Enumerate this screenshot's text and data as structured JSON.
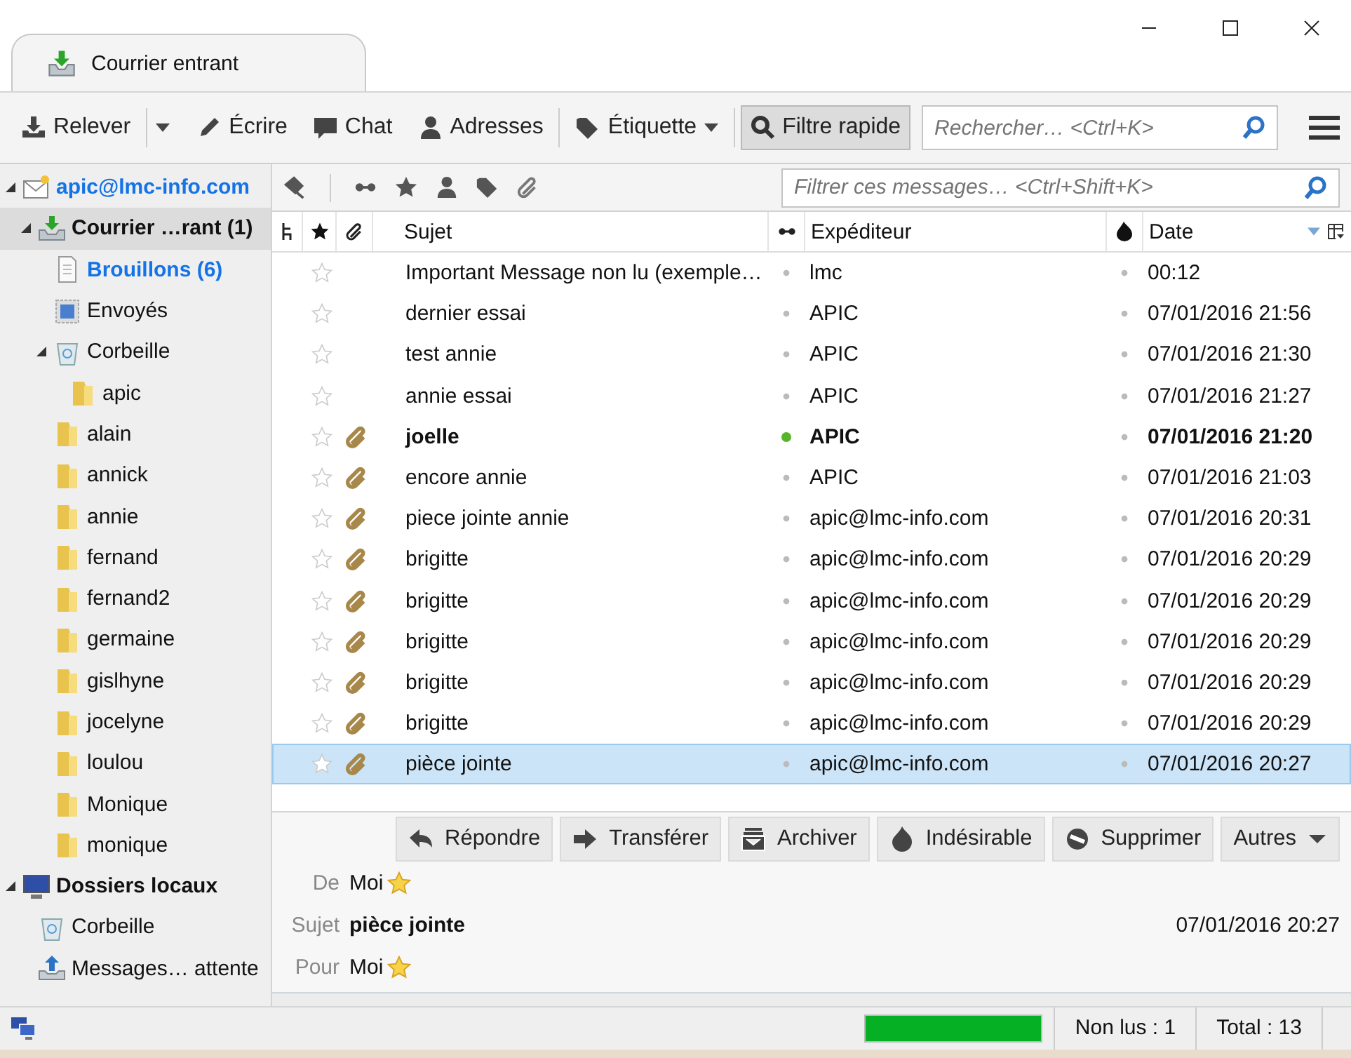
{
  "tab": {
    "title": "Courrier entrant"
  },
  "toolbar": {
    "buttons": [
      {
        "label": "Relever",
        "kind": "get",
        "split": true
      },
      {
        "label": "Écrire",
        "kind": "write",
        "split": false
      },
      {
        "label": "Chat",
        "kind": "chat",
        "split": false
      },
      {
        "label": "Adresses",
        "kind": "contacts",
        "split": false
      },
      {
        "label": "Étiquette",
        "kind": "tag",
        "split": false
      },
      {
        "label": "Filtre rapide",
        "kind": "filter",
        "split": false,
        "selected": true
      }
    ],
    "search": {
      "placeholder": "Rechercher… <Ctrl+K>"
    }
  },
  "sidebar": {
    "items": [
      {
        "label": "apic@lmc-info.com",
        "kind": "account",
        "selected": false,
        "expanded": true,
        "children": [
          {
            "label": "Courrier …rant (1)",
            "kind": "inbox",
            "selected": true,
            "expanded": true,
            "unread": true,
            "children": [
              {
                "label": "Brouillons (6)",
                "kind": "drafts",
                "selected": false,
                "unread": true,
                "new": true
              },
              {
                "label": "Envoyés",
                "kind": "sent",
                "selected": false
              },
              {
                "label": "Corbeille",
                "kind": "trash",
                "selected": false,
                "expanded": true,
                "children": [
                  {
                    "label": "apic",
                    "kind": "folder",
                    "selected": false
                  }
                ]
              },
              {
                "label": "alain",
                "kind": "folder",
                "selected": false
              },
              {
                "label": "annick",
                "kind": "folder",
                "selected": false
              },
              {
                "label": "annie",
                "kind": "folder",
                "selected": false
              },
              {
                "label": "fernand",
                "kind": "folder",
                "selected": false
              },
              {
                "label": "fernand2",
                "kind": "folder",
                "selected": false
              },
              {
                "label": "germaine",
                "kind": "folder",
                "selected": false
              },
              {
                "label": "gislhyne",
                "kind": "folder",
                "selected": false
              },
              {
                "label": "jocelyne",
                "kind": "folder",
                "selected": false
              },
              {
                "label": "loulou",
                "kind": "folder",
                "selected": false
              },
              {
                "label": "Monique",
                "kind": "folder",
                "selected": false
              },
              {
                "label": "monique",
                "kind": "folder",
                "selected": false
              }
            ]
          }
        ]
      },
      {
        "label": "Dossiers locaux",
        "kind": "local",
        "selected": false,
        "expanded": true,
        "children": [
          {
            "label": "Corbeille",
            "kind": "trash",
            "selected": false
          },
          {
            "label": "Messages… attente",
            "kind": "outbox",
            "selected": false
          }
        ]
      }
    ]
  },
  "quick_filter": {
    "placeholder": "Filtrer ces messages… <Ctrl+Shift+K>"
  },
  "table": {
    "columns": [
      {
        "label": "Sujet"
      },
      {
        "label": "Expéditeur"
      },
      {
        "label": "Date"
      }
    ],
    "rows": [
      {
        "subject": "Important Message non lu (exemple…",
        "sender": "lmc",
        "date": "00:12",
        "starred": false,
        "attachment": false,
        "unread": false,
        "selected": false
      },
      {
        "subject": "dernier essai",
        "sender": "APIC",
        "date": "07/01/2016 21:56",
        "starred": false,
        "attachment": false,
        "unread": false,
        "selected": false
      },
      {
        "subject": "test annie",
        "sender": "APIC",
        "date": "07/01/2016 21:30",
        "starred": false,
        "attachment": false,
        "unread": false,
        "selected": false
      },
      {
        "subject": "annie essai",
        "sender": "APIC",
        "date": "07/01/2016 21:27",
        "starred": false,
        "attachment": false,
        "unread": false,
        "selected": false
      },
      {
        "subject": "joelle",
        "sender": "APIC",
        "date": "07/01/2016 21:20",
        "starred": false,
        "attachment": true,
        "unread": true,
        "selected": false
      },
      {
        "subject": "encore annie",
        "sender": "APIC",
        "date": "07/01/2016 21:03",
        "starred": false,
        "attachment": true,
        "unread": false,
        "selected": false
      },
      {
        "subject": "piece jointe annie",
        "sender": "apic@lmc-info.com",
        "date": "07/01/2016 20:31",
        "starred": false,
        "attachment": true,
        "unread": false,
        "selected": false
      },
      {
        "subject": "brigitte",
        "sender": "apic@lmc-info.com",
        "date": "07/01/2016 20:29",
        "starred": false,
        "attachment": true,
        "unread": false,
        "selected": false
      },
      {
        "subject": "brigitte",
        "sender": "apic@lmc-info.com",
        "date": "07/01/2016 20:29",
        "starred": false,
        "attachment": true,
        "unread": false,
        "selected": false
      },
      {
        "subject": "brigitte",
        "sender": "apic@lmc-info.com",
        "date": "07/01/2016 20:29",
        "starred": false,
        "attachment": true,
        "unread": false,
        "selected": false
      },
      {
        "subject": "brigitte",
        "sender": "apic@lmc-info.com",
        "date": "07/01/2016 20:29",
        "starred": false,
        "attachment": true,
        "unread": false,
        "selected": false
      },
      {
        "subject": "brigitte",
        "sender": "apic@lmc-info.com",
        "date": "07/01/2016 20:29",
        "starred": false,
        "attachment": true,
        "unread": false,
        "selected": false
      },
      {
        "subject": "pièce jointe",
        "sender": "apic@lmc-info.com",
        "date": "07/01/2016 20:27",
        "starred": false,
        "attachment": true,
        "unread": false,
        "selected": true
      }
    ]
  },
  "message_header": {
    "buttons": [
      {
        "label": "Répondre",
        "kind": "reply"
      },
      {
        "label": "Transférer",
        "kind": "forward"
      },
      {
        "label": "Archiver",
        "kind": "archive"
      },
      {
        "label": "Indésirable",
        "kind": "junk"
      },
      {
        "label": "Supprimer",
        "kind": "delete"
      },
      {
        "label": "Autres",
        "kind": "more"
      }
    ],
    "from_label": "De",
    "from": "Moi",
    "subject_label": "Sujet",
    "subject": "pièce jointe",
    "date": "07/01/2016 20:27",
    "to_label": "Pour",
    "to": "Moi"
  },
  "status_bar": {
    "progress": {
      "level": 1
    },
    "unread": "Non lus : 1",
    "total": "Total : 13"
  }
}
